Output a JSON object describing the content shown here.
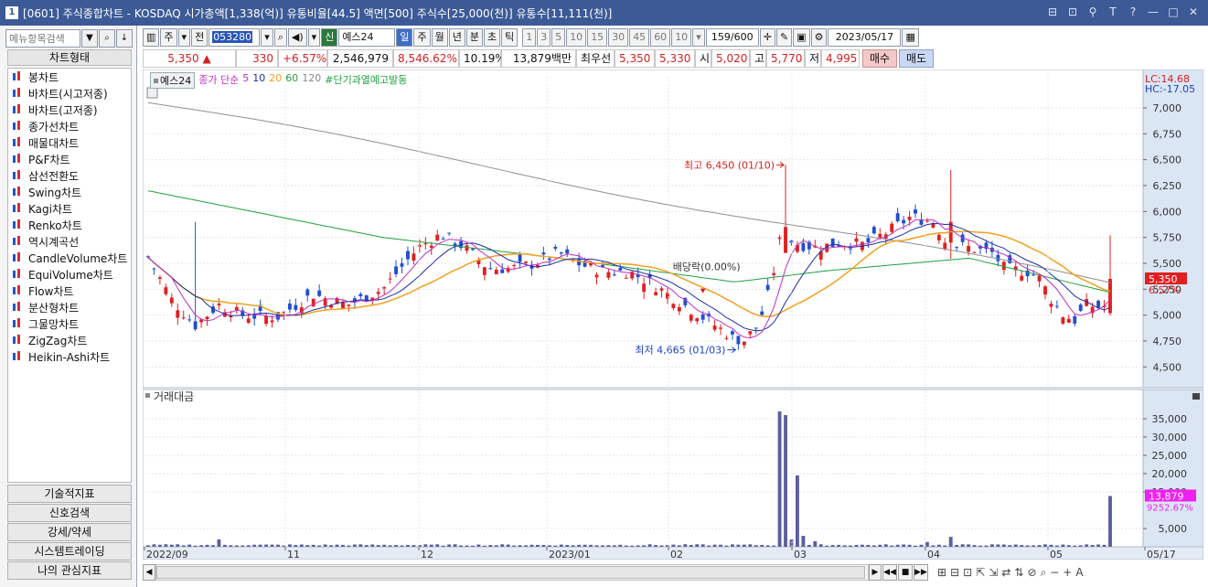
{
  "window": {
    "number": "1",
    "title": "[0601] 주식종합차트 - KOSDAQ 시가총액[1,338(억)] 유통비율[44.5] 액면[500] 주식수[25,000(천)] 유통수[11,111(천)]",
    "buttons": [
      "⊟",
      "⊡",
      "⚲",
      "T",
      "?",
      "—",
      "□",
      "✕"
    ]
  },
  "leftpanel": {
    "search_placeholder": "메뉴항목검색",
    "chart_type_header": "차트형태",
    "chart_types": [
      "봉차트",
      "바차트(시고저종)",
      "바차트(고저종)",
      "종가선차트",
      "매물대차트",
      "P&F차트",
      "삼선전환도",
      "Swing차트",
      "Kagi차트",
      "Renko차트",
      "역시계곡선",
      "CandleVolume차트",
      "EquiVolume차트",
      "Flow차트",
      "분산형차트",
      "그물망차트",
      "ZigZag차트",
      "Heikin-Ashi차트"
    ],
    "bottom_tabs": [
      "기술적지표",
      "신호검색",
      "강세/약세",
      "시스템트레이딩",
      "나의 관심지표"
    ]
  },
  "toolbar": {
    "market": "주",
    "prev": "전",
    "code": "053280",
    "new_badge": "신",
    "stock_name": "예스24",
    "periods": [
      "일",
      "주",
      "월",
      "년",
      "분",
      "초",
      "틱"
    ],
    "intervals": [
      "1",
      "3",
      "5",
      "10",
      "15",
      "30",
      "45",
      "60"
    ],
    "interval_value": "10",
    "count": "159",
    "count_total": "/600",
    "date": "2023/05/17"
  },
  "quote": {
    "price": "5,350",
    "arrow": "▲",
    "change": "330",
    "change_pct": "+6.57%",
    "volume": "2,546,979",
    "volume_pct": "8,546.62%",
    "turnover": "10.19%",
    "amount": "13,879백만",
    "best_label": "최우선",
    "ask": "5,350",
    "bid": "5,330",
    "open_label": "시",
    "open": "5,020",
    "high_label": "고",
    "high": "5,770",
    "low_label": "저",
    "low": "4,995",
    "buy_label": "매수",
    "sell_label": "매도"
  },
  "legend": {
    "stock": "예스24",
    "ma_label": "종가 단순",
    "ma5": "5",
    "ma10": "10",
    "ma20": "20",
    "ma60": "60",
    "ma120": "120",
    "signal": "#단기과열예고발동"
  },
  "colors": {
    "up": "#e02020",
    "down": "#1f4fd0",
    "ma5": "#c030c0",
    "ma10": "#1c2fa8",
    "ma20": "#f0a020",
    "ma60": "#20a040",
    "ma120": "#909090",
    "volume": "#5b5f9c"
  },
  "chart_data": [
    {
      "type": "candlestick",
      "ylim": [
        4300,
        7300
      ],
      "yticks": [
        "7,000",
        "6,750",
        "6,500",
        "6,250",
        "6,000",
        "5,750",
        "5,500",
        "5,250",
        "5,000",
        "4,750",
        "4,500"
      ],
      "xticks": [
        "2022/09",
        "11",
        "12",
        "2023/01",
        "02",
        "03",
        "04",
        "05",
        "05/17"
      ],
      "lc": "LC:14.68",
      "hc": "HC:-17.05",
      "last_price": "5,350",
      "last_pct": "6.57%",
      "annotations": {
        "high": "최고 6,450 (01/10)",
        "low": "최저 4,665 (01/03)",
        "dividend": "배당락(0.00%)"
      }
    },
    {
      "type": "bar",
      "title": "거래대금",
      "ylim": [
        0,
        40000
      ],
      "yticks": [
        "35,000",
        "30,000",
        "25,000",
        "20,000",
        "15,000",
        "5,000"
      ],
      "last_value": "13,879",
      "last_pct": "9252.67%"
    }
  ],
  "bottom_tools": [
    "⊞",
    "⊟",
    "⊡",
    "⇱",
    "⇲",
    "⇄",
    "⇅",
    "⊘",
    "⌕",
    "−",
    "+",
    "A"
  ]
}
